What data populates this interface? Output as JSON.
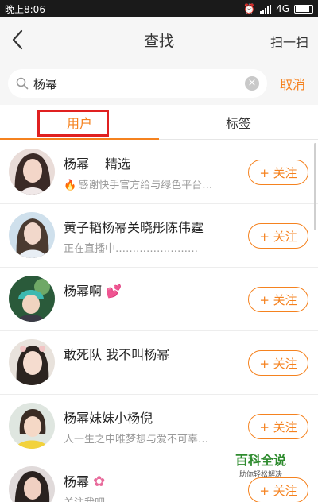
{
  "status_bar": {
    "time": "晚上8:06",
    "network": "4G"
  },
  "header": {
    "title": "查找",
    "scan_label": "扫一扫"
  },
  "search": {
    "value": "杨幂",
    "cancel_label": "取消"
  },
  "tabs": [
    {
      "label": "用户",
      "active": true
    },
    {
      "label": "标签",
      "active": false
    }
  ],
  "results": [
    {
      "name": "杨幂",
      "tag": "精选",
      "desc": "感谢快手官方给与绿色平台…",
      "follow_label": "+ 关注"
    },
    {
      "name": "黄子韬杨幂关晓彤陈伟霆",
      "desc": "正在直播中……………………",
      "follow_label": "+ 关注"
    },
    {
      "name": "杨幂啊",
      "desc": "",
      "follow_label": "+ 关注"
    },
    {
      "name": "敢死队 我不叫杨幂",
      "desc": "",
      "follow_label": "+ 关注"
    },
    {
      "name": "杨幂妹妹小杨倪",
      "desc": "人一生之中唯梦想与爱不可辜…",
      "follow_label": "+ 关注"
    },
    {
      "name": "杨幂",
      "desc": "关注我吧",
      "follow_label": "+ 关注"
    }
  ],
  "watermark": {
    "title": "百科全说",
    "subtitle": "助你轻松解决"
  },
  "colors": {
    "accent": "#f5821f",
    "highlight_box": "#e02020",
    "header_bg": "#f6f6f6"
  },
  "icons": [
    "back-arrow-icon",
    "search-icon",
    "clear-icon",
    "fire-icon",
    "heart-icon",
    "flower-icon"
  ]
}
